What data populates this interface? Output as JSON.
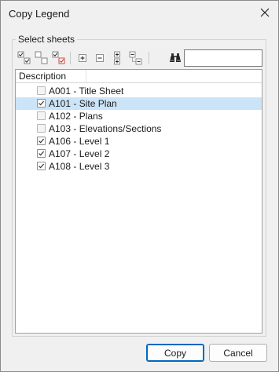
{
  "window": {
    "title": "Copy Legend"
  },
  "group": {
    "label": "Select sheets"
  },
  "toolbar": {
    "icons": [
      "check-all-icon",
      "uncheck-all-icon",
      "invert-check-icon",
      "expand-all-icon",
      "collapse-all-icon",
      "expand-selected-icon",
      "collapse-selected-icon",
      "find-binoculars-icon"
    ],
    "search_value": ""
  },
  "list": {
    "column_header": "Description",
    "rows": [
      {
        "label": "A001 - Title Sheet",
        "checked": false,
        "selected": false
      },
      {
        "label": "A101 - Site Plan",
        "checked": true,
        "selected": true
      },
      {
        "label": "A102 - Plans",
        "checked": false,
        "selected": false
      },
      {
        "label": "A103 - Elevations/Sections",
        "checked": false,
        "selected": false
      },
      {
        "label": "A106 - Level 1",
        "checked": true,
        "selected": false
      },
      {
        "label": "A107 - Level 2",
        "checked": true,
        "selected": false
      },
      {
        "label": "A108 - Level 3",
        "checked": true,
        "selected": false
      }
    ]
  },
  "buttons": {
    "copy": "Copy",
    "cancel": "Cancel"
  },
  "colors": {
    "selection": "#cce4f7",
    "accent": "#0067c0"
  }
}
